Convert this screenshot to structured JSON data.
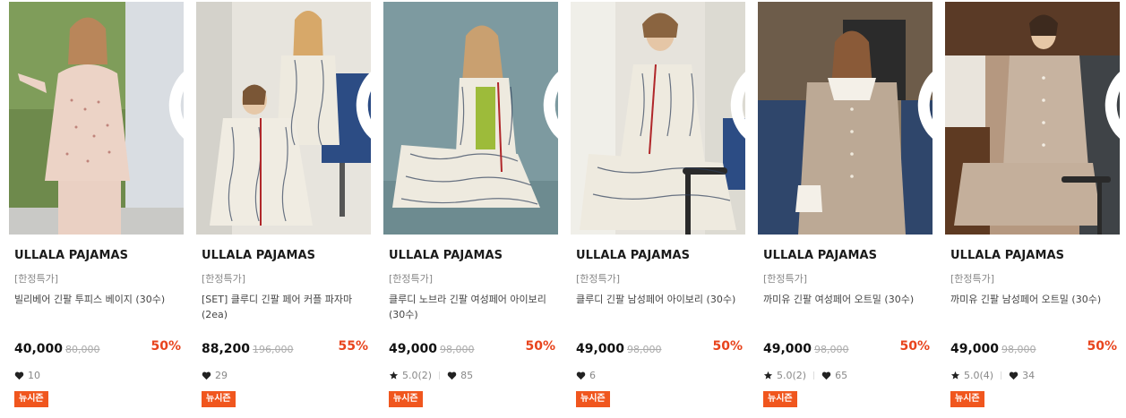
{
  "colors": {
    "discount": "#e8441d",
    "badge": "#f0561e"
  },
  "products": [
    {
      "brand": "ULLALA PAJAMAS",
      "tag": "[한정특가]",
      "name": "빌리베어 긴팔 투피스 베이지 (30수)",
      "price": "40,000",
      "original_price": "80,000",
      "discount": "50%",
      "rating": "",
      "likes": "10",
      "badge": "뉴시즌",
      "heart_icon": "heart-outline-icon"
    },
    {
      "brand": "ULLALA PAJAMAS",
      "tag": "[한정특가]",
      "name": "[SET] 클루디 긴팔 페어 커플 파자마(2ea)",
      "price": "88,200",
      "original_price": "196,000",
      "discount": "55%",
      "rating": "",
      "likes": "29",
      "badge": "뉴시즌",
      "heart_icon": "heart-outline-icon"
    },
    {
      "brand": "ULLALA PAJAMAS",
      "tag": "[한정특가]",
      "name": "클루디 노브라 긴팔 여성페어 아이보리 (30수)",
      "price": "49,000",
      "original_price": "98,000",
      "discount": "50%",
      "rating": "5.0(2)",
      "likes": "85",
      "badge": "뉴시즌",
      "heart_icon": "heart-outline-icon"
    },
    {
      "brand": "ULLALA PAJAMAS",
      "tag": "[한정특가]",
      "name": "클루디 긴팔 남성페어 아이보리 (30수)",
      "price": "49,000",
      "original_price": "98,000",
      "discount": "50%",
      "rating": "",
      "likes": "6",
      "badge": "뉴시즌",
      "heart_icon": "heart-outline-icon"
    },
    {
      "brand": "ULLALA PAJAMAS",
      "tag": "[한정특가]",
      "name": "까미유 긴팔 여성페어 오트밀 (30수)",
      "price": "49,000",
      "original_price": "98,000",
      "discount": "50%",
      "rating": "5.0(2)",
      "likes": "65",
      "badge": "뉴시즌",
      "heart_icon": "heart-outline-icon"
    },
    {
      "brand": "ULLALA PAJAMAS",
      "tag": "[한정특가]",
      "name": "까미유 긴팔 남성페어 오트밀 (30수)",
      "price": "49,000",
      "original_price": "98,000",
      "discount": "50%",
      "rating": "5.0(4)",
      "likes": "34",
      "badge": "뉴시즌",
      "heart_icon": "heart-outline-icon"
    }
  ]
}
